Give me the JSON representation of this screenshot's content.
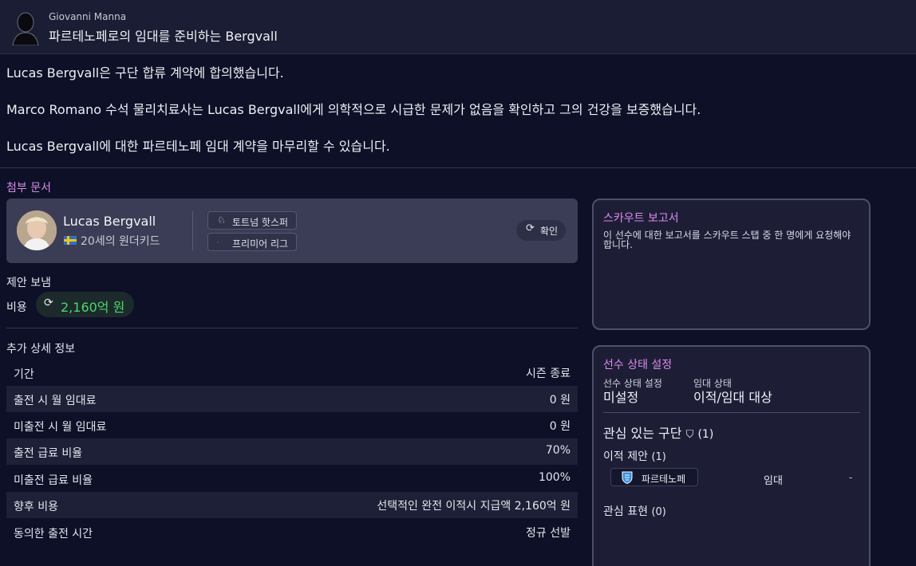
{
  "header": {
    "sender": "Giovanni Manna",
    "subject": "파르테노페로의 임대를 준비하는 Bergvall"
  },
  "body": {
    "paragraphs": [
      "Lucas Bergvall은 구단 합류 계약에 합의했습니다.",
      "Marco Romano 수석 물리치료사는 Lucas Bergvall에게 의학적으로 시급한 문제가 없음을 확인하고 그의 건강을 보증했습니다.",
      "Lucas Bergvall에 대한 파르테노페 임대 계약을 마무리할 수 있습니다."
    ]
  },
  "attachments": {
    "title": "첨부 문서",
    "player": {
      "name": "Lucas Bergvall",
      "description": "20세의 원더키드",
      "club": "토트넘 핫스퍼",
      "league": "프리미어 리그",
      "confirm_label": "확인"
    }
  },
  "offer": {
    "title": "제안 보냄",
    "cost_label": "비용",
    "cost_value": "2,160억 원"
  },
  "details": {
    "title": "추가 상세 정보",
    "rows": [
      {
        "key": "기간",
        "value": "시즌 종료"
      },
      {
        "key": "출전 시 월 임대료",
        "value": "0 원"
      },
      {
        "key": "미출전 시 월 임대료",
        "value": "0 원"
      },
      {
        "key": "출전 급료 비율",
        "value": "70%"
      },
      {
        "key": "미출전 급료 비율",
        "value": "100%"
      },
      {
        "key": "향후 비용",
        "value": "선택적인 완전 이적시 지급액 2,160억 원"
      },
      {
        "key": "동의한 출전 시간",
        "value": "정규 선발"
      }
    ]
  },
  "scout": {
    "title": "스카우트 보고서",
    "text": "이 선수에 대한 보고서를 스카우트 스탭 중 한 명에게 요청해야 합니다."
  },
  "status": {
    "title": "선수 상태 설정",
    "setting_label": "선수 상태 설정",
    "setting_value": "미설정",
    "loan_label": "임대 상태",
    "loan_value": "이적/임대 대상",
    "interested_label": "관심 있는 구단",
    "interested_count": "(1)",
    "transfer_offers_label": "이적 제안",
    "transfer_offers_count": "(1)",
    "offer_club": "파르테노페",
    "offer_type": "임대",
    "offer_extra": "-",
    "interest_label": "관심 표현",
    "interest_count": "(0)"
  },
  "colors": {
    "accent_purple": "#dc8bec",
    "cost_green": "#49d76b",
    "background": "#0d1027"
  }
}
